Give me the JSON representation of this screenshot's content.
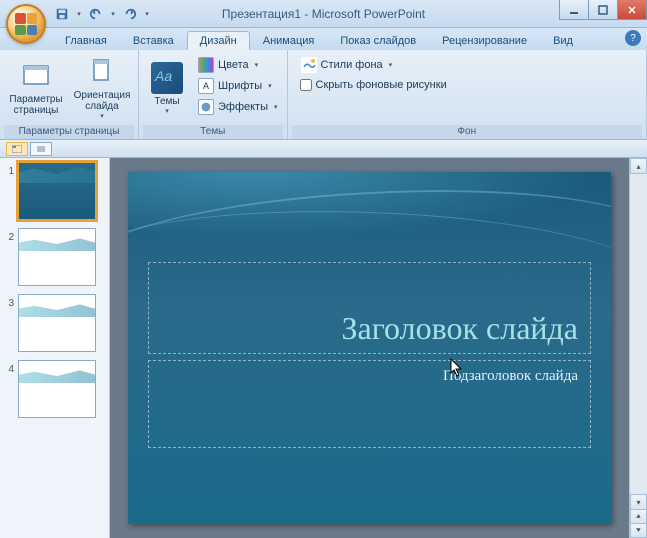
{
  "titlebar": {
    "title": "Презентация1 - Microsoft PowerPoint"
  },
  "tabs": {
    "items": [
      "Главная",
      "Вставка",
      "Дизайн",
      "Анимация",
      "Показ слайдов",
      "Рецензирование",
      "Вид"
    ],
    "active_index": 2
  },
  "ribbon": {
    "page_setup": {
      "page_params": "Параметры\nстраницы",
      "orientation": "Ориентация\nслайда",
      "label": "Параметры страницы"
    },
    "themes": {
      "themes_btn": "Темы",
      "colors": "Цвета",
      "fonts": "Шрифты",
      "effects": "Эффекты",
      "label": "Темы"
    },
    "background": {
      "styles": "Стили фона",
      "hide_graphics": "Скрыть фоновые рисунки",
      "label": "Фон"
    }
  },
  "slide": {
    "title_placeholder": "Заголовок слайда",
    "subtitle_placeholder": "Подзаголовок слайда"
  },
  "thumbnails": {
    "count": 4,
    "selected": 1
  }
}
